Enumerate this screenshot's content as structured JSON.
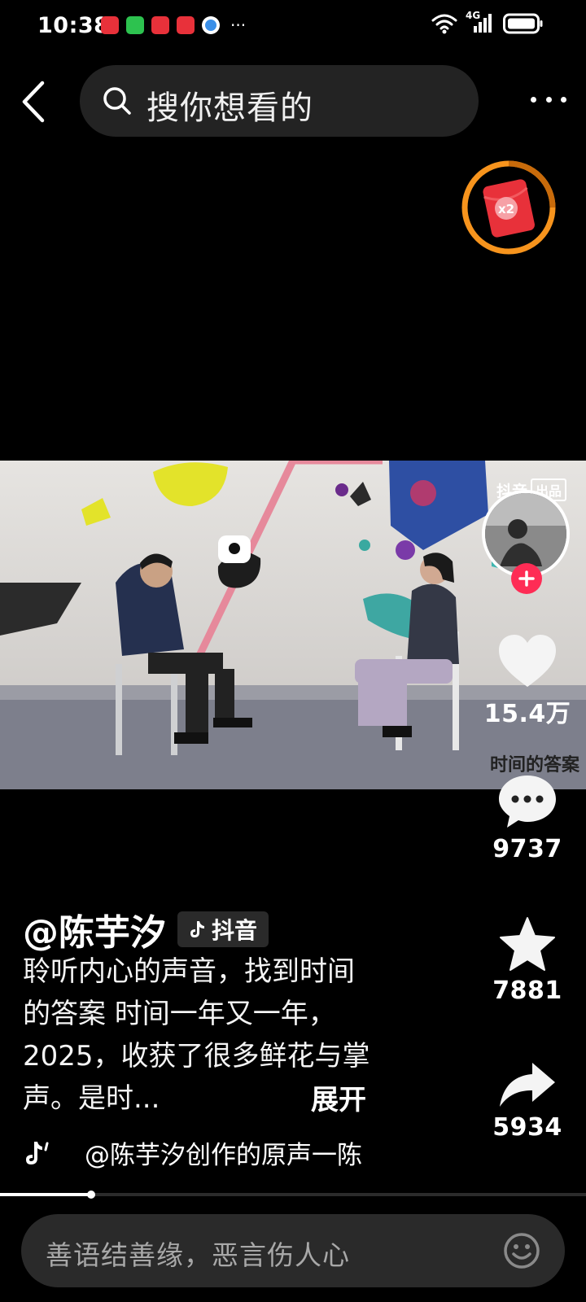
{
  "status_bar": {
    "time": "10:38",
    "more": "···",
    "network": "4G"
  },
  "top_bar": {
    "search_placeholder": "搜你想看的"
  },
  "red_packet": {
    "multiplier": "x2"
  },
  "video": {
    "tag_prefix": "抖音",
    "tag_box": "出品",
    "caption": "时间的答案"
  },
  "actions": {
    "likes": "15.4万",
    "comments": "9737",
    "favorites": "7881",
    "shares": "5934"
  },
  "post": {
    "author": "@陈芋汐",
    "platform": "抖音",
    "description": "聆听内心的声音，找到时间的答案 时间一年又一年，2025，收获了很多鲜花与掌声。是时...",
    "expand": "展开",
    "music": "@陈芋汐创作的原声一陈"
  },
  "progress": {
    "played_fraction": 0.155
  },
  "comment_bar": {
    "placeholder": "善语结善缘，恶言伤人心"
  },
  "colors": {
    "accent": "#fe2c55",
    "red_packet": "#e8313a",
    "ring": "#f7941d",
    "background": "#000000"
  },
  "icons": [
    "back-arrow-icon",
    "search-icon",
    "more-dots-icon",
    "heart-icon",
    "comment-icon",
    "star-icon",
    "share-icon",
    "tiktok-icon",
    "music-note-icon",
    "emoji-icon",
    "plus-icon",
    "wifi-icon",
    "signal-icon",
    "battery-icon"
  ]
}
